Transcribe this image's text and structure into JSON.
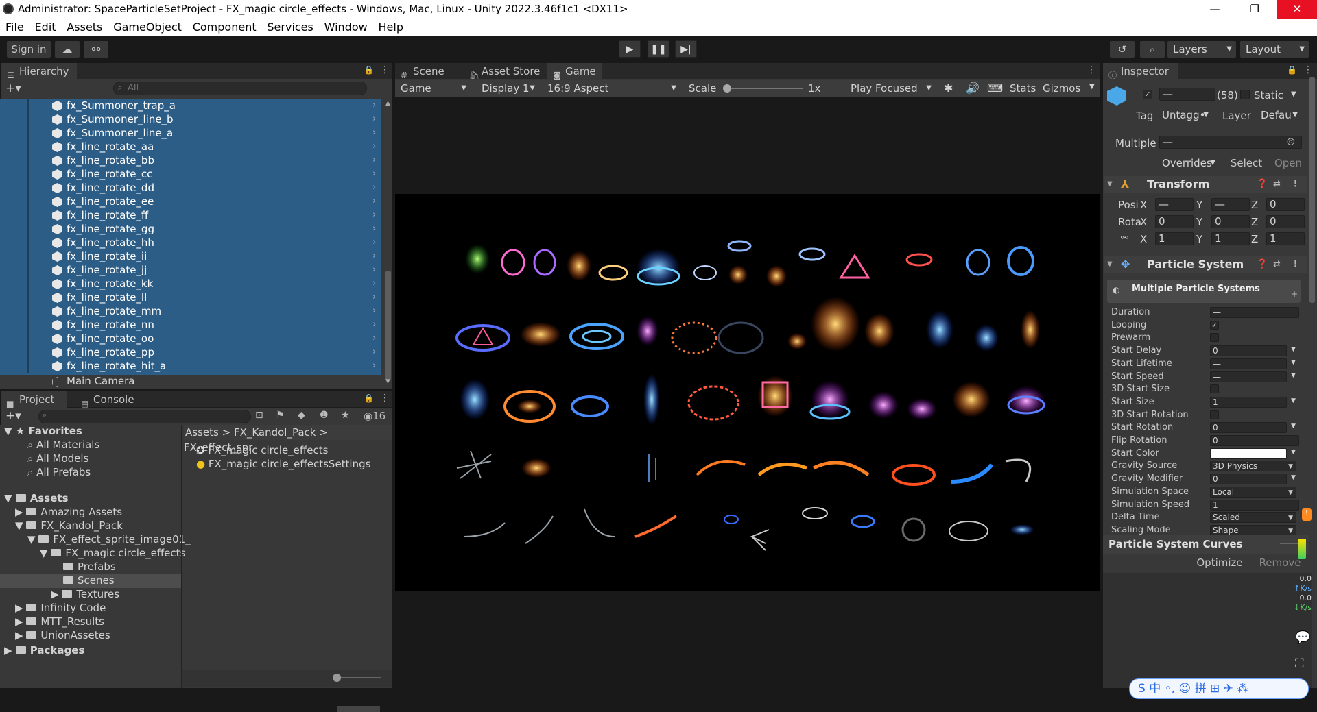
{
  "titlebar": {
    "title": "Administrator: SpaceParticleSetProject - FX_magic circle_effects - Windows, Mac, Linux - Unity 2022.3.46f1c1 <DX11>",
    "minimize": "—",
    "restore": "❐",
    "close": "✕"
  },
  "menu": [
    "File",
    "Edit",
    "Assets",
    "GameObject",
    "Component",
    "Services",
    "Window",
    "Help"
  ],
  "toolbar": {
    "sign_in": "Sign in",
    "layers": "Layers",
    "layout": "Layout"
  },
  "hierarchy": {
    "tab": "Hierarchy",
    "search_placeholder": "All",
    "items": [
      "fx_Summoner_trap_a",
      "fx_Summoner_line_b",
      "fx_Summoner_line_a",
      "fx_line_rotate_aa",
      "fx_line_rotate_bb",
      "fx_line_rotate_cc",
      "fx_line_rotate_dd",
      "fx_line_rotate_ee",
      "fx_line_rotate_ff",
      "fx_line_rotate_gg",
      "fx_line_rotate_hh",
      "fx_line_rotate_ii",
      "fx_line_rotate_jj",
      "fx_line_rotate_kk",
      "fx_line_rotate_ll",
      "fx_line_rotate_mm",
      "fx_line_rotate_nn",
      "fx_line_rotate_oo",
      "fx_line_rotate_pp",
      "fx_line_rotate_hit_a"
    ],
    "main_camera": "Main Camera"
  },
  "game_view": {
    "tabs": [
      "Scene",
      "Asset Store",
      "Game"
    ],
    "game_dropdown": "Game",
    "display": "Display 1",
    "aspect": "16:9 Aspect",
    "scale_label": "Scale",
    "scale_value": "1x",
    "play_focused": "Play Focused",
    "stats": "Stats",
    "gizmos": "Gizmos"
  },
  "project": {
    "tabs": [
      "Project",
      "Console"
    ],
    "hidden_count": "16",
    "favorites_label": "Favorites",
    "favorites": [
      "All Materials",
      "All Models",
      "All Prefabs"
    ],
    "assets_label": "Assets",
    "tree": [
      "Amazing Assets",
      "FX_Kandol_Pack",
      "FX_effect_sprite_image01_",
      "FX_magic circle_effects",
      "Prefabs",
      "Scenes",
      "Textures",
      "Infinity Code",
      "MTT_Results",
      "UnionAssetes"
    ],
    "packages_label": "Packages",
    "breadcrumb": [
      "Assets",
      "FX_Kandol_Pack",
      "FX_effect_spr"
    ],
    "files": [
      "FX_magic circle_effects",
      "FX_magic circle_effectsSettings"
    ]
  },
  "inspector": {
    "tab": "Inspector",
    "name_field": "—",
    "count": "(58)",
    "static_label": "Static",
    "tag_label": "Tag",
    "tag_value": "Untagg•",
    "layer_label": "Layer",
    "layer_value": "Defau",
    "multiple_label": "Multiple",
    "multiple_value": "—",
    "overrides": "Overrides",
    "select": "Select",
    "open": "Open",
    "transform": {
      "title": "Transform",
      "rows": [
        {
          "label": "Posi",
          "x": "—",
          "y": "—",
          "z": "0"
        },
        {
          "label": "Rota",
          "x": "0",
          "y": "0",
          "z": "0"
        },
        {
          "label": "",
          "x": "1",
          "y": "1",
          "z": "1"
        }
      ]
    },
    "particle_system": {
      "title": "Particle System",
      "subheader": "Multiple Particle Systems",
      "props": [
        {
          "label": "Duration",
          "value": "—",
          "kind": "field"
        },
        {
          "label": "Looping",
          "value": "✓",
          "kind": "check"
        },
        {
          "label": "Prewarm",
          "value": "",
          "kind": "check"
        },
        {
          "label": "Start Delay",
          "value": "0",
          "kind": "dd"
        },
        {
          "label": "Start Lifetime",
          "value": "—",
          "kind": "dd"
        },
        {
          "label": "Start Speed",
          "value": "—",
          "kind": "dd"
        },
        {
          "label": "3D Start Size",
          "value": "",
          "kind": "check"
        },
        {
          "label": "Start Size",
          "value": "1",
          "kind": "dd"
        },
        {
          "label": "3D Start Rotation",
          "value": "",
          "kind": "check"
        },
        {
          "label": "Start Rotation",
          "value": "0",
          "kind": "dd"
        },
        {
          "label": "Flip Rotation",
          "value": "0",
          "kind": "field"
        },
        {
          "label": "Start Color",
          "value": "",
          "kind": "color"
        },
        {
          "label": "Gravity Source",
          "value": "3D Physics",
          "kind": "select"
        },
        {
          "label": "Gravity Modifier",
          "value": "0",
          "kind": "dd"
        },
        {
          "label": "Simulation Space",
          "value": "Local",
          "kind": "select"
        },
        {
          "label": "Simulation Speed",
          "value": "1",
          "kind": "field"
        },
        {
          "label": "Delta Time",
          "value": "Scaled",
          "kind": "select"
        },
        {
          "label": "Scaling Mode",
          "value": "Shape",
          "kind": "select"
        }
      ]
    },
    "curves_title": "Particle System Curves",
    "optimize": "Optimize",
    "remove": "Remove"
  },
  "side_stats": {
    "up_value": "0.0",
    "up_unit": "K/s",
    "down_value": "0.0",
    "down_unit": "K/s"
  },
  "ime": "中 ◦, ☺ 拼 ⊞ ✈ ⁂"
}
